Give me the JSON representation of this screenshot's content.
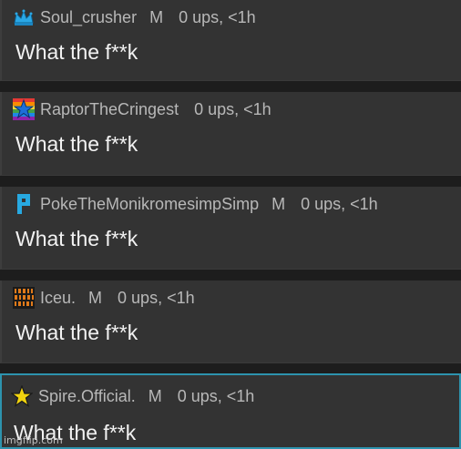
{
  "comments": [
    {
      "username": "Soul_crusher",
      "mod_badge": "M",
      "ups": "0 ups, <1h",
      "text": "What the f**k",
      "avatar_icon": "crown-icon",
      "avatar_color": "#2aa8e6"
    },
    {
      "username": "RaptorTheCringest",
      "mod_badge": "",
      "ups": "0 ups, <1h",
      "text": "What the f**k",
      "avatar_icon": "rainbow-star-icon",
      "avatar_color": "#1e6fd9"
    },
    {
      "username": "PokeTheMonikromesimpSimp",
      "mod_badge": "M",
      "ups": "0 ups, <1h",
      "text": "What the f**k",
      "avatar_icon": "p-logo-icon",
      "avatar_color": "#27a9e1"
    },
    {
      "username": "Iceu.",
      "mod_badge": "M",
      "ups": "0 ups, <1h",
      "text": "What the f**k",
      "avatar_icon": "binary-grid-icon",
      "avatar_color": "#e07a1a"
    },
    {
      "username": "Spire.Official.",
      "mod_badge": "M",
      "ups": "0 ups, <1h",
      "text": "What the f**k",
      "avatar_icon": "yellow-star-icon",
      "avatar_color": "#f2d40f"
    }
  ],
  "watermark": "imgflip.com",
  "colors": {
    "background": "#1d1d1d",
    "card": "#333333",
    "selected_border": "#2d93ae",
    "meta_text": "#b8b8b8",
    "body_text": "#f2f2f2"
  }
}
